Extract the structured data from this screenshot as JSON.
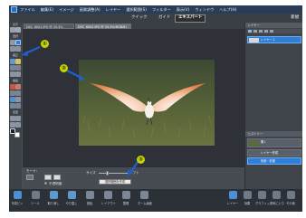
{
  "menu": {
    "items": [
      "ファイル",
      "編集(E)",
      "イメージ",
      "画質調整(A)",
      "レイヤー",
      "選択範囲(S)",
      "フィルター",
      "表示(V)",
      "ウィンドウ",
      "ヘルプ(H)"
    ]
  },
  "modes": {
    "quick": "クイック",
    "guided": "ガイド",
    "expert": "エキスパート",
    "new": "新規"
  },
  "document": {
    "tabs": [
      "DSC_6001.JPG @ 33.3%",
      "DSC_6002.JPG @ 33.3%(RGB/8)"
    ]
  },
  "toolbox": {
    "sections": [
      "表示",
      "選択",
      "補正",
      "描画",
      "変更"
    ]
  },
  "callouts": [
    "①",
    "②",
    "③"
  ],
  "layers_panel": {
    "header": "レイヤー",
    "layer_name": "レイヤー 1",
    "background": "背景"
  },
  "history_panel": {
    "header": "ヒストリー",
    "items": [
      "開く",
      "レイヤー作成",
      "色相・彩度"
    ]
  },
  "tool_options": {
    "mode_label": "モード：",
    "checkbox_label": "不透明度",
    "size_label": "サイズ",
    "set_button": "選択範囲を作成",
    "soft_label": "ソフト"
  },
  "taskbar": {
    "items": [
      "写真ビン",
      "ツール",
      "取り消し",
      "やり直し",
      "回転",
      "レイアウト",
      "整理",
      "ホーム画面",
      "レイヤー",
      "効果",
      "グラフィック",
      "お気に入り",
      "その他"
    ]
  },
  "colors": {
    "menubar": "#2a3d57",
    "selection_blue": "#2f7ed8",
    "callout": "#c8d400",
    "arrow": "#1f5fd6"
  },
  "icons": {
    "app": "photoshop-elements-icon",
    "zoom": "zoom-icon",
    "hand": "hand-icon",
    "brush": "brush-icon"
  }
}
